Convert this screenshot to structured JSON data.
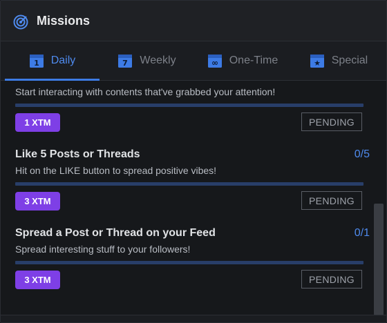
{
  "header": {
    "title": "Missions",
    "icon": "target-icon"
  },
  "tabs": [
    {
      "label": "Daily",
      "icon": "calendar-day-icon",
      "badge": "1",
      "active": true
    },
    {
      "label": "Weekly",
      "icon": "calendar-week-icon",
      "badge": "7",
      "active": false
    },
    {
      "label": "One-Time",
      "icon": "calendar-infinity-icon",
      "badge": "∞",
      "active": false
    },
    {
      "label": "Special",
      "icon": "calendar-star-icon",
      "badge": "★",
      "active": false
    }
  ],
  "missions": [
    {
      "title": "",
      "progress": "",
      "description": "Start interacting with contents that've grabbed your attention!",
      "reward": "1 XTM",
      "status": "PENDING"
    },
    {
      "title": "Like 5 Posts or Threads",
      "progress": "0/5",
      "description": "Hit on the LIKE button to spread positive vibes!",
      "reward": "3 XTM",
      "status": "PENDING"
    },
    {
      "title": "Spread a Post or Thread on your Feed",
      "progress": "0/1",
      "description": "Spread interesting stuff to your followers!",
      "reward": "3 XTM",
      "status": "PENDING"
    }
  ],
  "colors": {
    "accent": "#3d7be5",
    "reward_badge": "#7e3fe6",
    "progress_track": "#283e69"
  }
}
